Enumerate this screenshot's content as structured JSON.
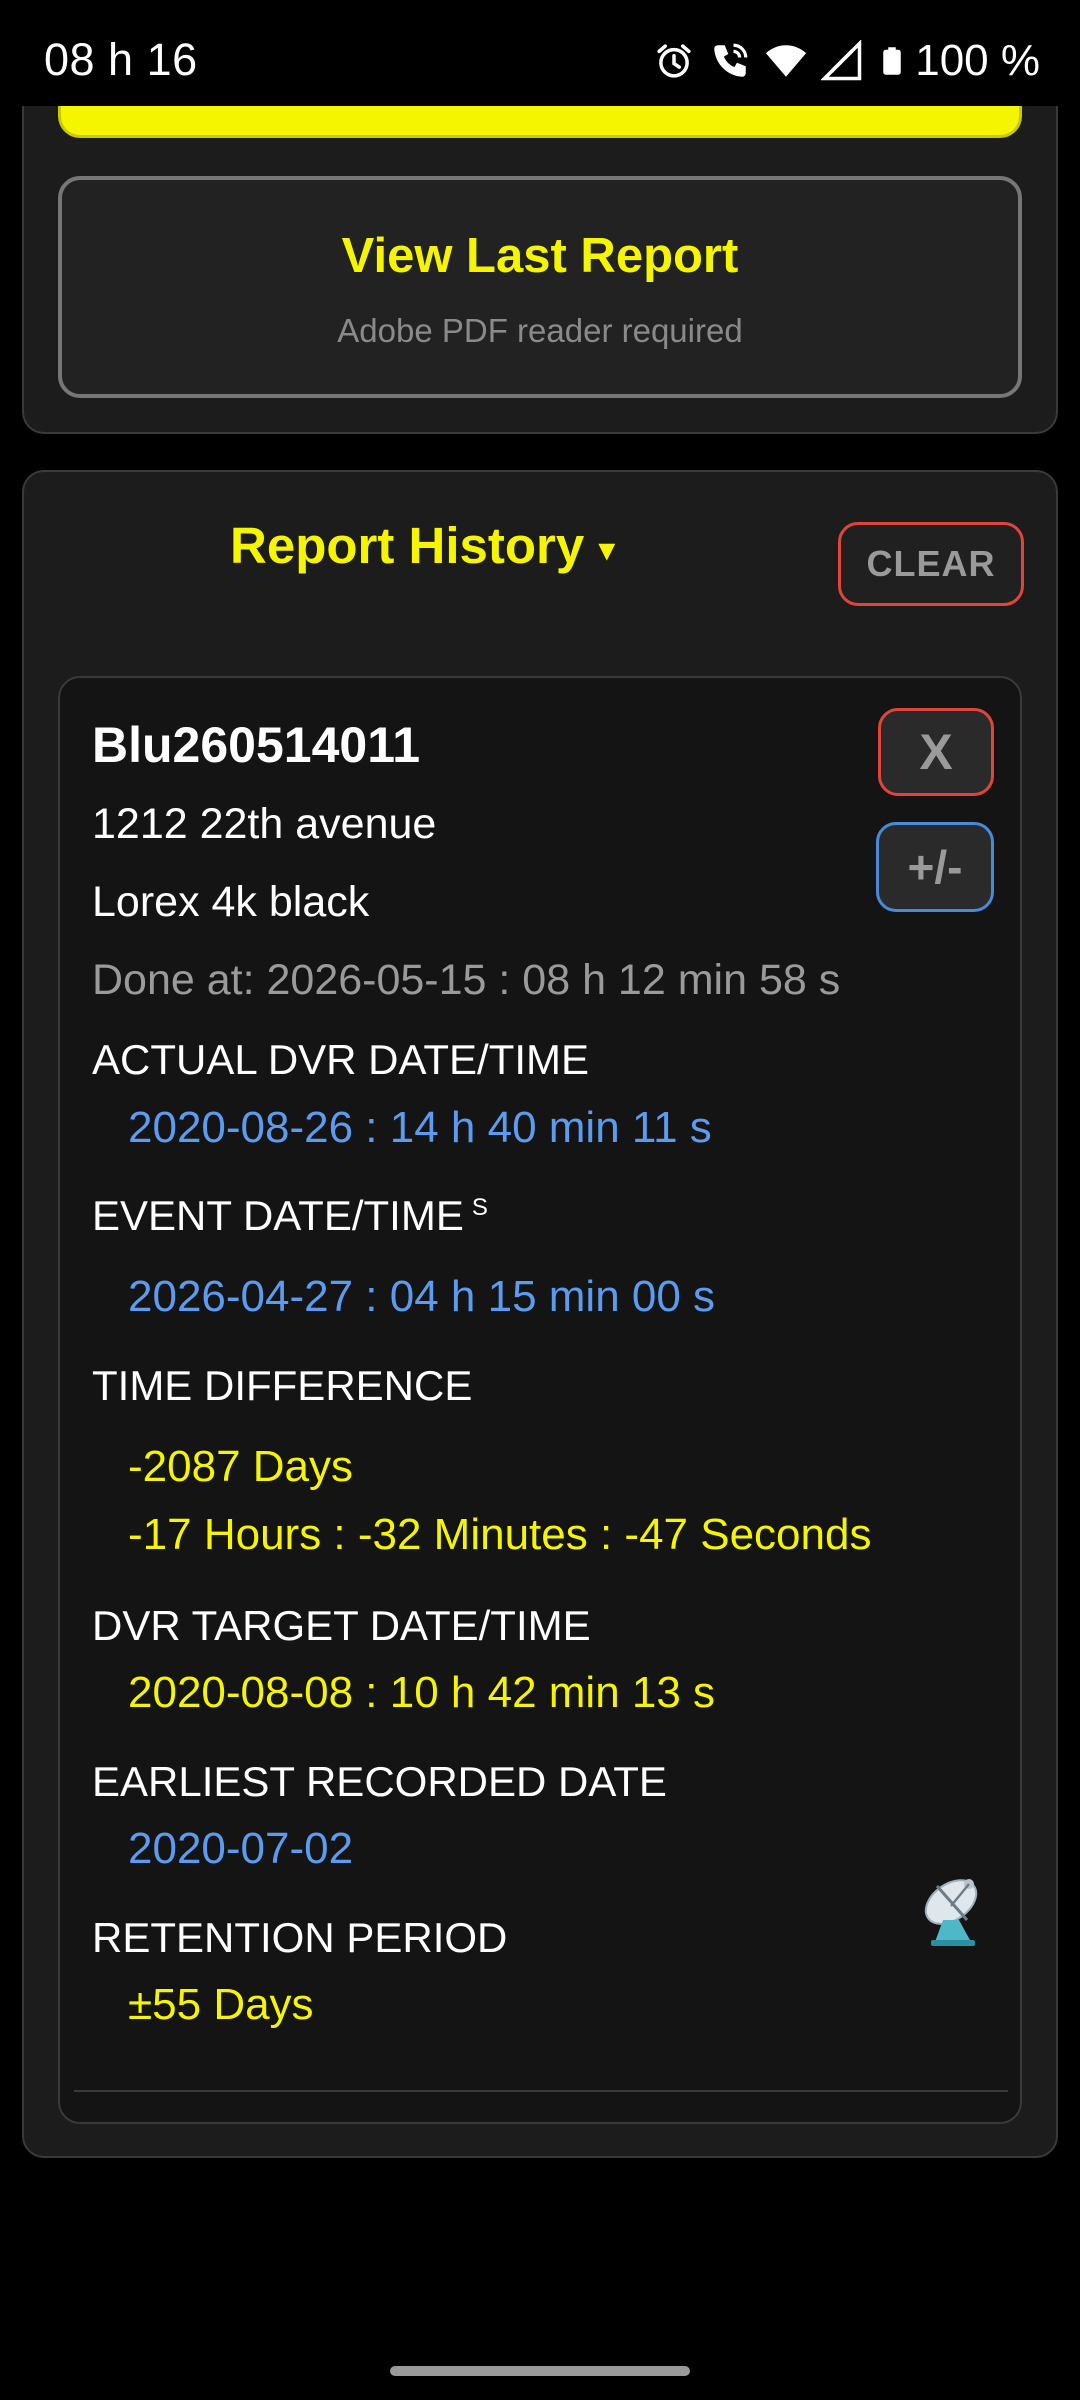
{
  "status_bar": {
    "time": "08 h 16",
    "battery": "100 %",
    "icons": [
      "alarm-icon",
      "wifi-call-icon",
      "wifi-icon",
      "signal-icon",
      "battery-icon"
    ]
  },
  "last_report": {
    "title": "View Last Report",
    "subtitle": "Adobe PDF reader required"
  },
  "history": {
    "title": "Report History",
    "caret": "▾",
    "clear_label": "CLEAR",
    "entry": {
      "id": "Blu260514011",
      "address": "1212 22th avenue",
      "device": "Lorex 4k black",
      "done_at": "Done at: 2026-05-15 : 08 h 12 min 58 s",
      "delete_label": "X",
      "adjust_label": "+/-",
      "actual_dvr_label": "ACTUAL DVR DATE/TIME",
      "actual_dvr_value": "2020-08-26 : 14 h 40 min 11 s",
      "event_label": "EVENT DATE/TIME",
      "event_sup": "S",
      "event_value": "2026-04-27 : 04 h 15 min 00 s",
      "time_diff_label": "TIME DIFFERENCE",
      "time_diff_days": "-2087 Days",
      "time_diff_hms": "-17 Hours : -32 Minutes : -47 Seconds",
      "dvr_target_label": "DVR TARGET DATE/TIME",
      "dvr_target_value": "2020-08-08 : 10 h 42 min 13 s",
      "earliest_label": "EARLIEST RECORDED DATE",
      "earliest_value": "2020-07-02",
      "retention_label": "RETENTION PERIOD",
      "retention_value": "±55 Days",
      "satellite_icon": "satellite-dish-icon"
    }
  },
  "colors": {
    "accent_yellow": "#f5f500",
    "value_blue": "#5b9cf0",
    "danger_red": "#e0443c",
    "button_blue": "#4a88d8"
  }
}
